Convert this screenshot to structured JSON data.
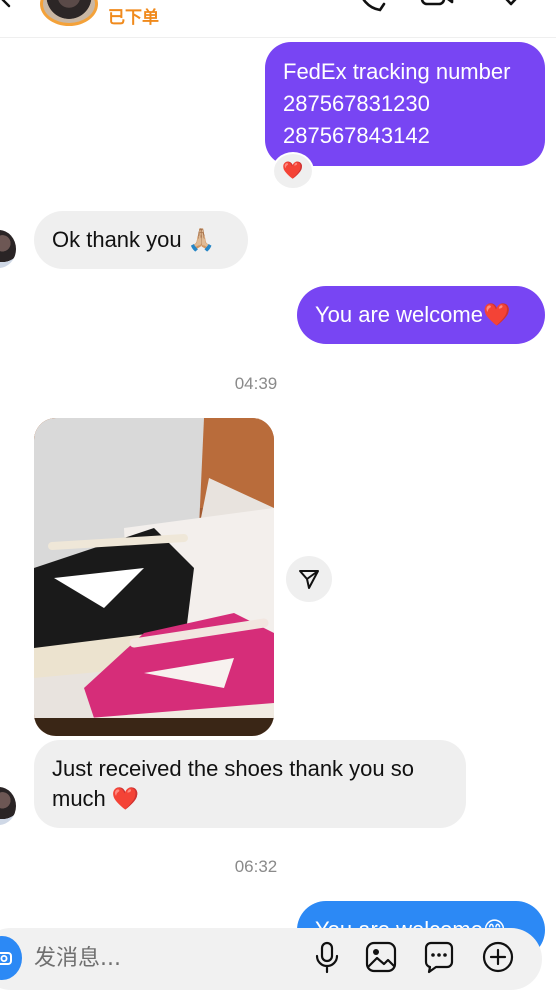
{
  "header": {
    "status_text": "已下单",
    "icons": [
      "back-arrow-icon",
      "phone-icon",
      "video-icon",
      "heart-icon"
    ]
  },
  "messages": [
    {
      "direction": "outgoing",
      "text": "FedEx tracking number\n287567831230\n287567843142",
      "reaction": "❤️"
    },
    {
      "direction": "incoming",
      "text": "Ok thank you 🙏🏼"
    },
    {
      "direction": "outgoing",
      "text": "You are welcome❤️"
    },
    {
      "type": "timestamp",
      "text": "04:39"
    },
    {
      "direction": "incoming",
      "type": "image",
      "image_icon": "shoes-photo"
    },
    {
      "direction": "incoming",
      "text": "Just received the shoes thank you so\nmuch ❤️"
    },
    {
      "type": "timestamp",
      "text": "06:32"
    },
    {
      "direction": "outgoing",
      "text": "You are welcome😊"
    }
  ],
  "composer": {
    "placeholder": "发消息...",
    "value": "",
    "icons": [
      "camera-icon",
      "microphone-icon",
      "gallery-icon",
      "sticker-icon",
      "plus-icon"
    ]
  },
  "colors": {
    "outgoing_bubble": "#7845f3",
    "outgoing_bubble_latest": "#2c89f5",
    "incoming_bubble": "#efefef",
    "status": "#f08a1c",
    "camera_button": "#2c89f5"
  }
}
